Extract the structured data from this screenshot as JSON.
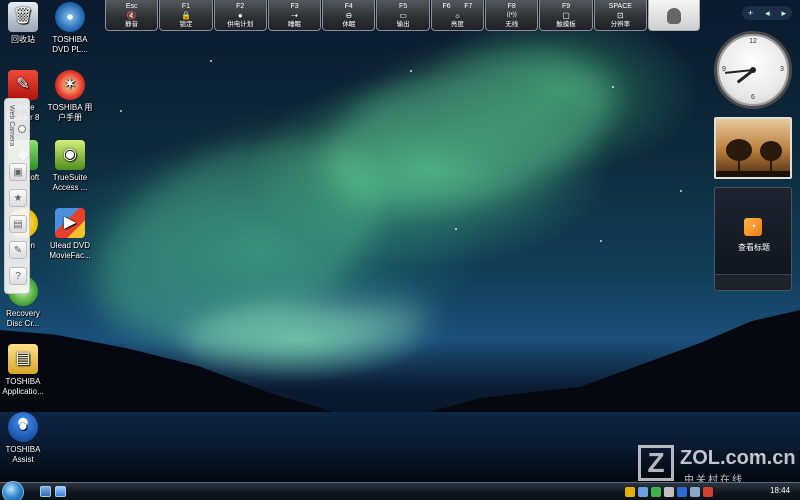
{
  "desktop_icons": [
    {
      "id": "recycle-bin",
      "label": "回收站",
      "icon": "recycle-bin-icon"
    },
    {
      "id": "toshiba-dvd",
      "label": "TOSHIBA\nDVD PL...",
      "icon": "dvd-player-icon"
    },
    {
      "id": "adobe-reader",
      "label": "Adobe\nReader 8",
      "icon": "adobe-reader-icon"
    },
    {
      "id": "toshiba-manual",
      "label": "TOSHIBA 用\n户手册",
      "icon": "manual-icon"
    },
    {
      "id": "microsoft",
      "label": "Microsoft",
      "icon": "microsoft-icon"
    },
    {
      "id": "truesuite",
      "label": "TrueSuite\nAccess ...",
      "icon": "truesuite-icon"
    },
    {
      "id": "norton",
      "label": "Norton",
      "icon": "norton-icon"
    },
    {
      "id": "ulead-dvd",
      "label": "Ulead DVD\nMovieFac...",
      "icon": "ulead-dvd-icon"
    },
    {
      "id": "recovery",
      "label": "Recovery\nDisc Cr...",
      "icon": "recovery-disc-icon"
    },
    {
      "id": "toshiba-app",
      "label": "TOSHIBA\nApplicatio...",
      "icon": "folder-icon"
    },
    {
      "id": "toshiba-assist",
      "label": "TOSHIBA\nAssist",
      "icon": "assist-icon"
    }
  ],
  "fn_keys": [
    {
      "key": "Esc",
      "icon": "mute-icon",
      "glyph": "🔇",
      "label": "静音"
    },
    {
      "key": "F1",
      "icon": "lock-icon",
      "glyph": "🔒",
      "label": "锁定"
    },
    {
      "key": "F2",
      "icon": "power-plan-icon",
      "glyph": "●",
      "label": "供电计划"
    },
    {
      "key": "F3",
      "icon": "sleep-icon",
      "glyph": "⇢",
      "label": "睡眠"
    },
    {
      "key": "F4",
      "icon": "hibernate-icon",
      "glyph": "⊖",
      "label": "休眠"
    },
    {
      "key": "F5",
      "icon": "display-output-icon",
      "glyph": "▭",
      "label": "输出"
    },
    {
      "key": "F6       F7",
      "icon": "brightness-icon",
      "glyph": "☼",
      "label": "亮度"
    },
    {
      "key": "F8",
      "icon": "wireless-icon",
      "glyph": "((•))",
      "label": "无线"
    },
    {
      "key": "F9",
      "icon": "touchpad-icon",
      "glyph": "▢",
      "label": "触摸板"
    },
    {
      "key": "SPACE",
      "icon": "resolution-icon",
      "glyph": "⊡",
      "label": "分辨率"
    }
  ],
  "webcam_panel": {
    "title": "Web Camera",
    "buttons": [
      {
        "icon": "display-icon",
        "glyph": "▣"
      },
      {
        "icon": "star-icon",
        "glyph": "★"
      },
      {
        "icon": "settings-panel-icon",
        "glyph": "▤"
      },
      {
        "icon": "wrench-icon",
        "glyph": "✎"
      },
      {
        "icon": "help-icon",
        "glyph": "?"
      }
    ]
  },
  "sidebar": {
    "controls": {
      "add": "+",
      "prev": "◂",
      "next": "▸"
    },
    "clock": {
      "hour": 7,
      "minute": 44,
      "ticks": [
        "12",
        "3",
        "6",
        "9"
      ]
    },
    "feed": {
      "label": "查看标题",
      "glyph": "◔"
    }
  },
  "taskbar": {
    "time": "18:44"
  },
  "watermark": {
    "logo": "Z",
    "brand": "ZOL.com.cn",
    "tagline": "中关村在线"
  }
}
